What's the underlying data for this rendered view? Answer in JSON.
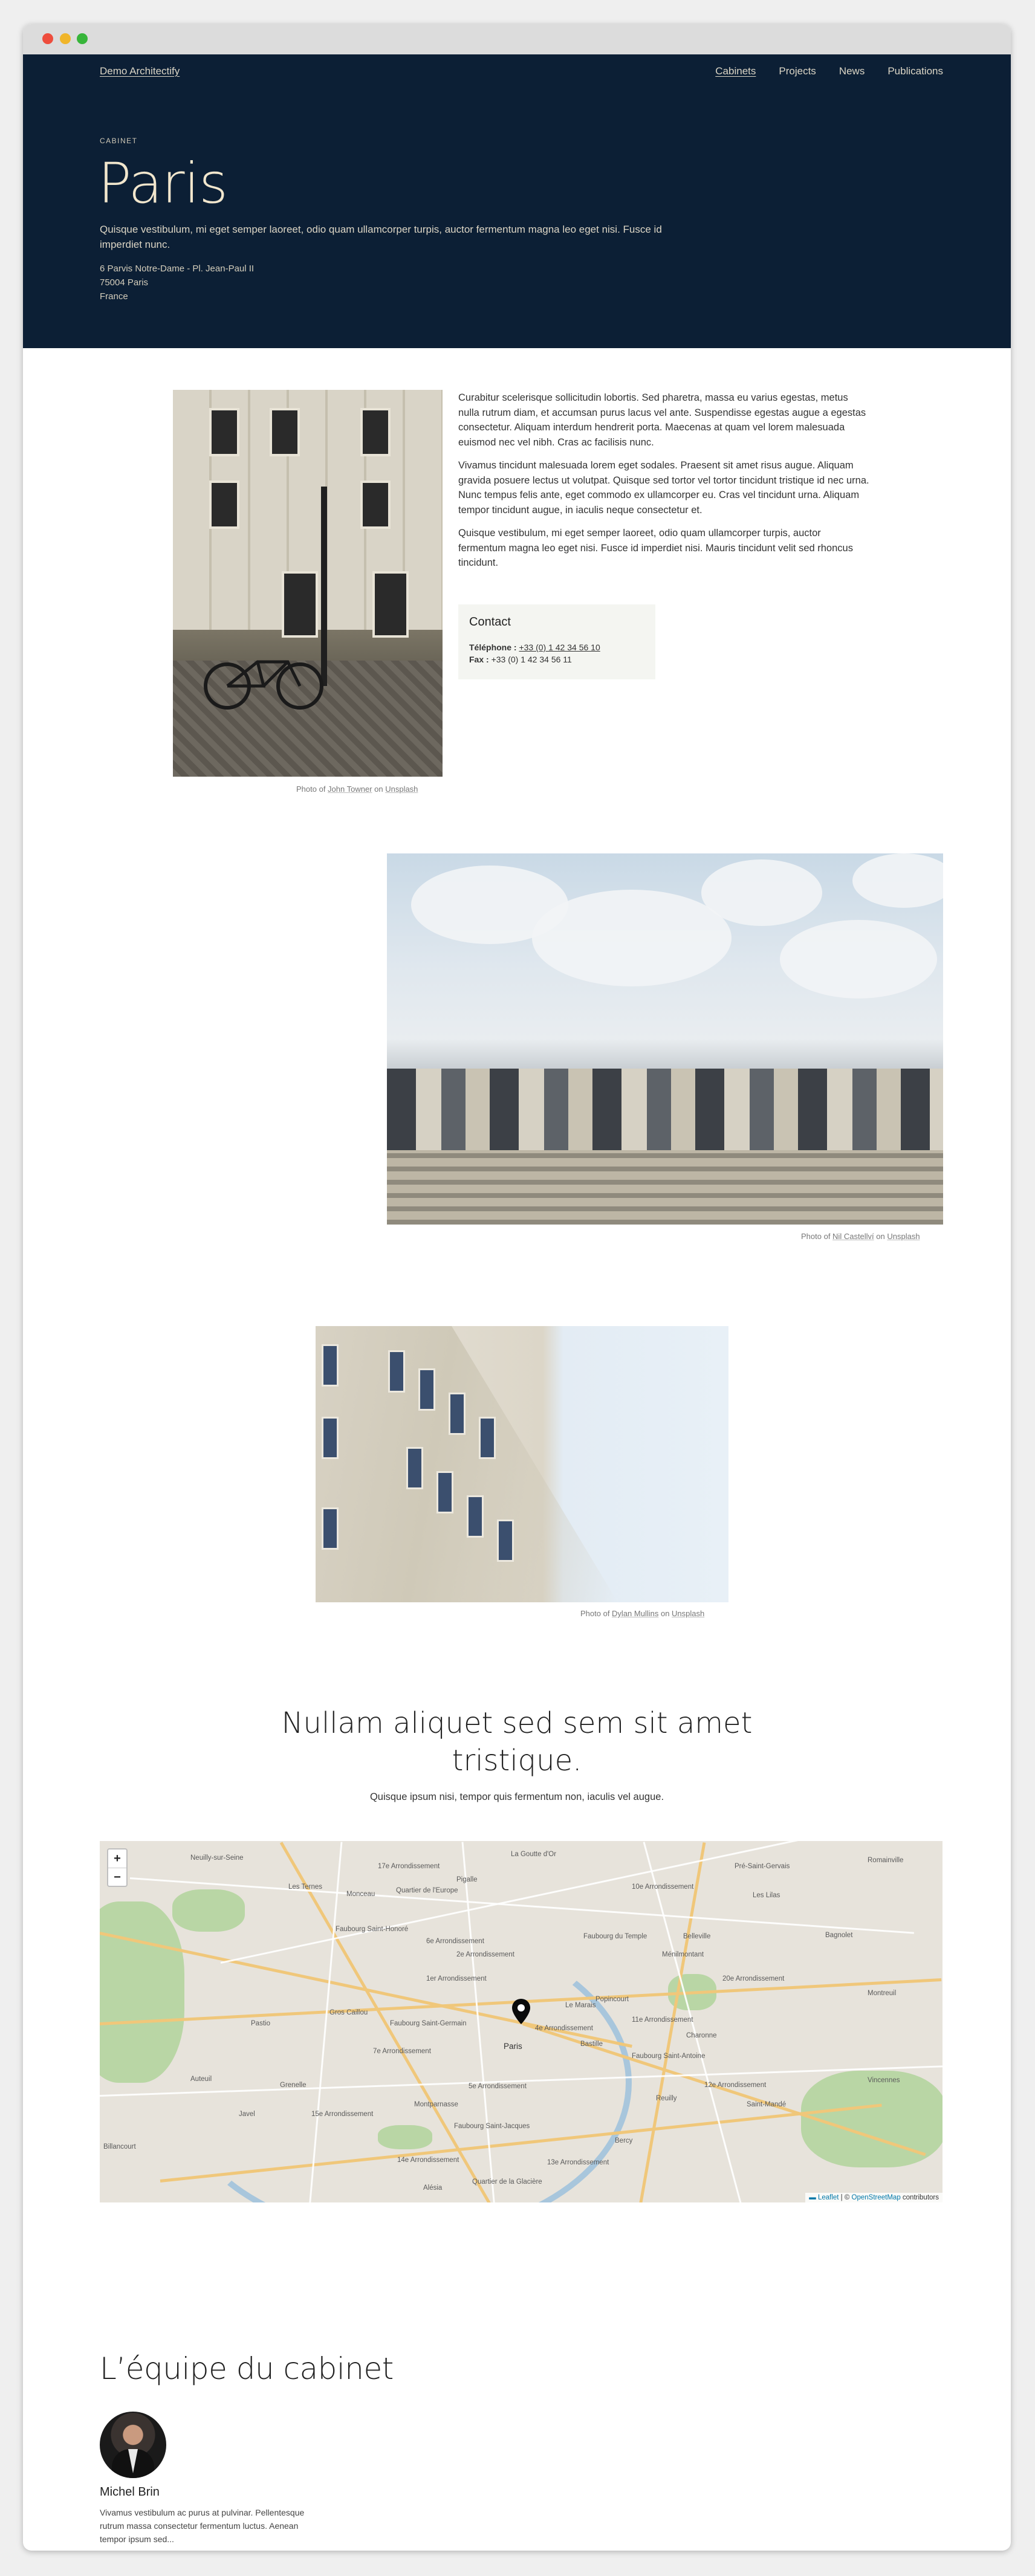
{
  "header": {
    "brand": "Demo Architectify",
    "nav": [
      {
        "label": "Cabinets",
        "active": true
      },
      {
        "label": "Projects",
        "active": false
      },
      {
        "label": "News",
        "active": false
      },
      {
        "label": "Publications",
        "active": false
      }
    ]
  },
  "hero": {
    "eyebrow": "CABINET",
    "title": "Paris",
    "lead": "Quisque vestibulum, mi eget semper laoreet, odio quam ullamcorper turpis, auctor fermentum magna leo eget nisi. Fusce id imperdiet nunc.",
    "address": [
      "6 Parvis Notre-Dame - Pl. Jean-Paul II",
      "75004 Paris",
      "France"
    ]
  },
  "intro": {
    "paragraphs": [
      "Curabitur scelerisque sollicitudin lobortis. Sed pharetra, massa eu varius egestas, metus nulla rutrum diam, et accumsan purus lacus vel ante. Suspendisse egestas augue a egestas consectetur. Aliquam interdum hendrerit porta. Maecenas at quam vel lorem malesuada euismod nec vel nibh. Cras ac facilisis nunc.",
      "Vivamus tincidunt malesuada lorem eget sodales. Praesent sit amet risus augue. Aliquam gravida posuere lectus ut volutpat. Quisque sed tortor vel tortor tincidunt tristique id nec urna. Nunc tempus felis ante, eget commodo ex ullamcorper eu. Cras vel tincidunt urna. Aliquam tempor tincidunt augue, in iaculis neque consectetur et.",
      "Quisque vestibulum, mi eget semper laoreet, odio quam ullamcorper turpis, auctor fermentum magna leo eget nisi. Fusce id imperdiet nisi. Mauris tincidunt velit sed rhoncus tincidunt."
    ],
    "contact": {
      "title": "Contact",
      "phone_label": "Téléphone :",
      "phone": "+33 (0) 1 42 34 56 10",
      "fax_label": "Fax :",
      "fax": "+33 (0) 1 42 34 56 11"
    }
  },
  "captions": [
    {
      "prefix": "Photo of ",
      "author": "John Towner",
      "mid": " on ",
      "source": "Unsplash"
    },
    {
      "prefix": "Photo of ",
      "author": "Nil Castellví",
      "mid": " on ",
      "source": "Unsplash"
    },
    {
      "prefix": "Photo of ",
      "author": "Dylan Mullins",
      "mid": " on ",
      "source": "Unsplash"
    }
  ],
  "section": {
    "title_line1": "Nullam aliquet sed sem sit amet",
    "title_line2": "tristique.",
    "subtitle": "Quisque ipsum nisi, tempor quis fermentum non, iaculis vel augue."
  },
  "map": {
    "zoom_in": "+",
    "zoom_out": "−",
    "attribution_leaflet": "Leaflet",
    "attribution_sep": " | © ",
    "attribution_osm": "OpenStreetMap",
    "attribution_tail": " contributors",
    "labels": [
      "Neuilly-sur-Seine",
      "17e Arrondissement",
      "La Goutte d'Or",
      "Pré-Saint-Gervais",
      "Romainville",
      "Les Ternes",
      "Monceau",
      "Quartier de l'Europe",
      "Pigalle",
      "10e Arrondissement",
      "Les Lilas",
      "Faubourg Saint-Honoré",
      "Faubourg du Temple",
      "Belleville",
      "Bagnolet",
      "2e Arrondissement",
      "Ménilmontant",
      "Montreuil",
      "1er Arrondissement",
      "20e Arrondissement",
      "Gros Caillou",
      "Le Marais",
      "Popincourt",
      "Faubourg Saint-Germain",
      "11e Arrondissement",
      "Paris",
      "Bastille",
      "Charonne",
      "7e Arrondissement",
      "4e Arrondissement",
      "Faubourg Saint-Antoine",
      "Auteuil",
      "Grenelle",
      "Vincennes",
      "5e Arrondissement",
      "Montparnasse",
      "12e Arrondissement",
      "Reuilly",
      "Saint-Mandé",
      "Faubourg Saint-Jacques",
      "15e Arrondissement",
      "Bercy",
      "Javel",
      "Billancourt",
      "14e Arrondissement",
      "13e Arrondissement",
      "Alésia",
      "Quartier de la Glacière",
      "Pastio",
      "6e Arrondissement"
    ]
  },
  "team": {
    "title": "L’équipe du cabinet",
    "members": [
      {
        "name": "Michel Brin",
        "bio": "Vivamus vestibulum ac purus at pulvinar. Pellentesque rutrum massa consectetur fermentum luctus. Aenean tempor ipsum sed..."
      }
    ]
  }
}
